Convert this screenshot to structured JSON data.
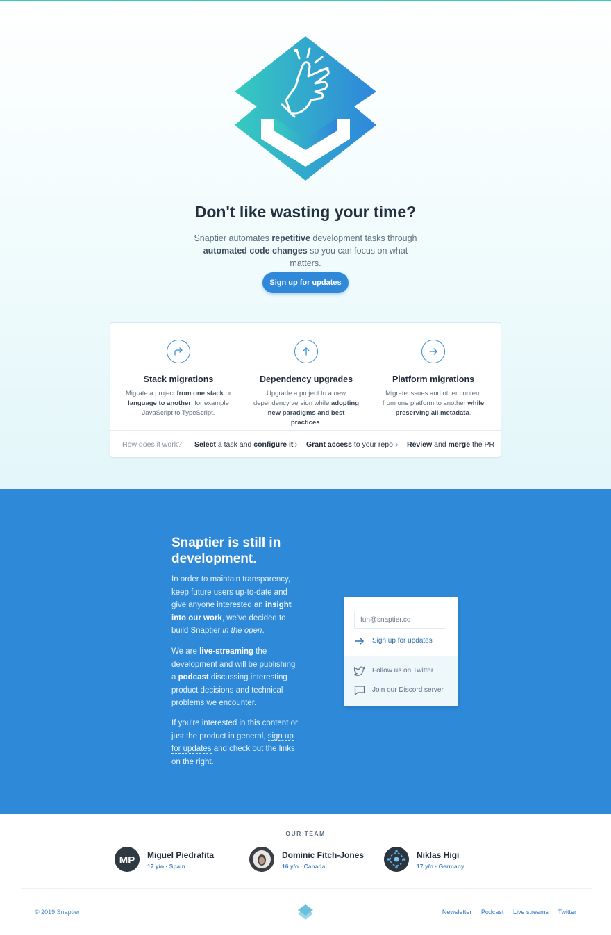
{
  "hero": {
    "title": "Don't like wasting your time?",
    "sub_1": "Snaptier automates ",
    "sub_2": "repetitive",
    "sub_3": " development tasks through ",
    "sub_4": "automated code changes",
    "sub_5": " so you can focus on what matters.",
    "cta": "Sign up for updates"
  },
  "features": [
    {
      "icon": "share-arrow-icon",
      "title": "Stack migrations",
      "d1": "Migrate a project ",
      "d2": "from one stack",
      "d3": " or ",
      "d4": "language to another",
      "d5": ", for example JavaScript to TypeScript."
    },
    {
      "icon": "arrow-up-icon",
      "title": "Dependency upgrades",
      "d1": "Upgrade a project to a new dependency version while ",
      "d2": "adopting new paradigms and best practices",
      "d3": "."
    },
    {
      "icon": "arrow-right-icon",
      "title": "Platform migrations",
      "d1": "Migrate issues and other content from one platform to another ",
      "d2": "while preserving all metadata",
      "d3": "."
    }
  ],
  "how": {
    "label": "How does it work?",
    "s1a": "Select",
    "s1b": " a task and ",
    "s1c": "configure it",
    "s2a": "Grant access",
    "s2b": " to your repo",
    "s3a": "Review",
    "s3b": " and ",
    "s3c": "merge",
    "s3d": " the PR",
    "chevron": "›"
  },
  "dev": {
    "title": "Snaptier is still in development.",
    "p1a": "In order to maintain transparency, keep future users up-to-date and give anyone interested an ",
    "p1b": "insight into our work",
    "p1c": ", we've decided to build Snaptier ",
    "p1d": "in the open",
    "p1e": ".",
    "p2a": "We are ",
    "p2b": "live-streaming",
    "p2c": " the development and will be publishing a ",
    "p2d": "podcast",
    "p2e": " discussing interesting product decisions and technical problems we encounter.",
    "p3a": "If you're interested in this content or just the product in general, ",
    "p3b": "sign up for updates",
    "p3c": " and check out the links on the right."
  },
  "signup": {
    "email_placeholder": "fun@snaptier.co",
    "signup_label": "Sign up for updates",
    "twitter_label": "Follow us on Twitter",
    "discord_label": "Join our Discord server"
  },
  "team": {
    "label": "OUR TEAM",
    "members": [
      {
        "name": "Miguel Piedrafita",
        "info": "17 y/o · Spain",
        "initials": "MP"
      },
      {
        "name": "Dominic Fitch-Jones",
        "info": "16 y/o · Canada"
      },
      {
        "name": "Niklas Higi",
        "info": "17 y/o · Germany"
      }
    ]
  },
  "footer": {
    "copyright": "© 2019 Snaptier",
    "links": [
      "Newsletter",
      "Podcast",
      "Live streams",
      "Twitter"
    ]
  },
  "colors": {
    "primary_blue": "#2e8ad9",
    "teal": "#3cc7c0",
    "dark_text": "#23303f"
  }
}
